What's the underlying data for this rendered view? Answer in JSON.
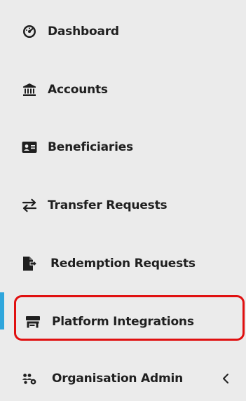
{
  "sidebar": {
    "items": [
      {
        "label": "Dashboard",
        "icon": "dashboard-gauge-icon"
      },
      {
        "label": "Accounts",
        "icon": "bank-icon"
      },
      {
        "label": "Beneficiaries",
        "icon": "id-card-icon"
      },
      {
        "label": "Transfer Requests",
        "icon": "transfer-arrows-icon"
      },
      {
        "label": "Redemption Requests",
        "icon": "file-export-icon"
      },
      {
        "label": "Platform Integrations",
        "icon": "store-icon"
      },
      {
        "label": "Organisation Admin",
        "icon": "users-cog-icon"
      }
    ],
    "active_index": 5,
    "active_color": "#2fa6dc",
    "highlight_color": "#e01010"
  }
}
